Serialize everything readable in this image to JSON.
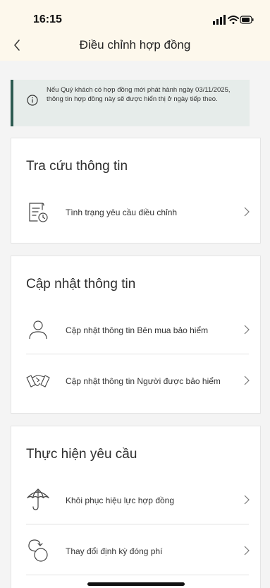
{
  "status_bar": {
    "time": "16:15"
  },
  "nav": {
    "title": "Điều chỉnh hợp đồng"
  },
  "notice": {
    "text": "Nếu Quý khách có hợp đồng mới phát hành ngày 03/11/2025, thông tin hợp đồng này sẽ được hiển thị ở ngày tiếp theo."
  },
  "sections": {
    "lookup": {
      "title": "Tra cứu thông tin",
      "items": [
        {
          "label": "Tình trạng yêu cầu điều chỉnh",
          "icon": "document-clock-icon"
        }
      ]
    },
    "update": {
      "title": "Cập nhật thông tin",
      "items": [
        {
          "label": "Cập nhật thông tin Bên mua bảo hiểm",
          "icon": "person-icon"
        },
        {
          "label": "Cập nhật thông tin Người được bảo hiểm",
          "icon": "handshake-icon"
        }
      ]
    },
    "request": {
      "title": "Thực hiện yêu cầu",
      "items": [
        {
          "label": "Khôi phục hiệu lực hợp đồng",
          "icon": "umbrella-icon"
        },
        {
          "label": "Thay đổi định kỳ đóng phí",
          "icon": "cycle-icon"
        }
      ]
    }
  },
  "colors": {
    "header_bg": "#fdf8ec",
    "accent": "#2d5b51",
    "page_bg": "#f4f4f4"
  }
}
